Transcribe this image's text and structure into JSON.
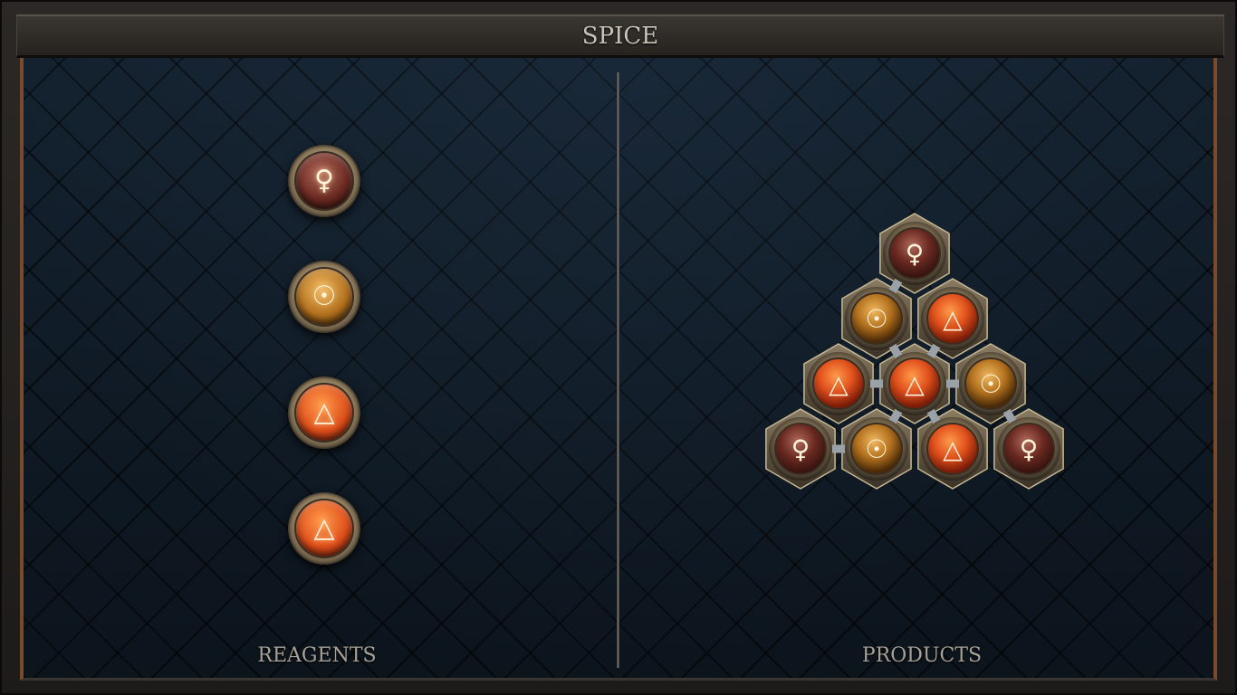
{
  "title": "SPICE",
  "reagents": {
    "label": "REAGENTS",
    "items": [
      {
        "element": "venus",
        "symbol": "♀"
      },
      {
        "element": "salt",
        "symbol": "☉"
      },
      {
        "element": "fire",
        "symbol": "△"
      },
      {
        "element": "fire",
        "symbol": "△"
      }
    ]
  },
  "products": {
    "label": "PRODUCTS",
    "molecule": [
      {
        "element": "venus",
        "symbol": "♀"
      },
      {
        "element": "salt",
        "symbol": "☉"
      },
      {
        "element": "fire",
        "symbol": "△"
      },
      {
        "element": "fire",
        "symbol": "△"
      },
      {
        "element": "fire",
        "symbol": "△"
      },
      {
        "element": "salt",
        "symbol": "☉"
      },
      {
        "element": "venus",
        "symbol": "♀"
      },
      {
        "element": "salt",
        "symbol": "☉"
      },
      {
        "element": "fire",
        "symbol": "△"
      },
      {
        "element": "venus",
        "symbol": "♀"
      }
    ]
  },
  "colors": {
    "frame": "#2b2825",
    "board": "#0f1a24",
    "accent_copper": "#7a4a2a",
    "label_text": "#a7a197",
    "venus": "#6b2a22",
    "salt": "#b4721e",
    "fire": "#e0501c"
  }
}
